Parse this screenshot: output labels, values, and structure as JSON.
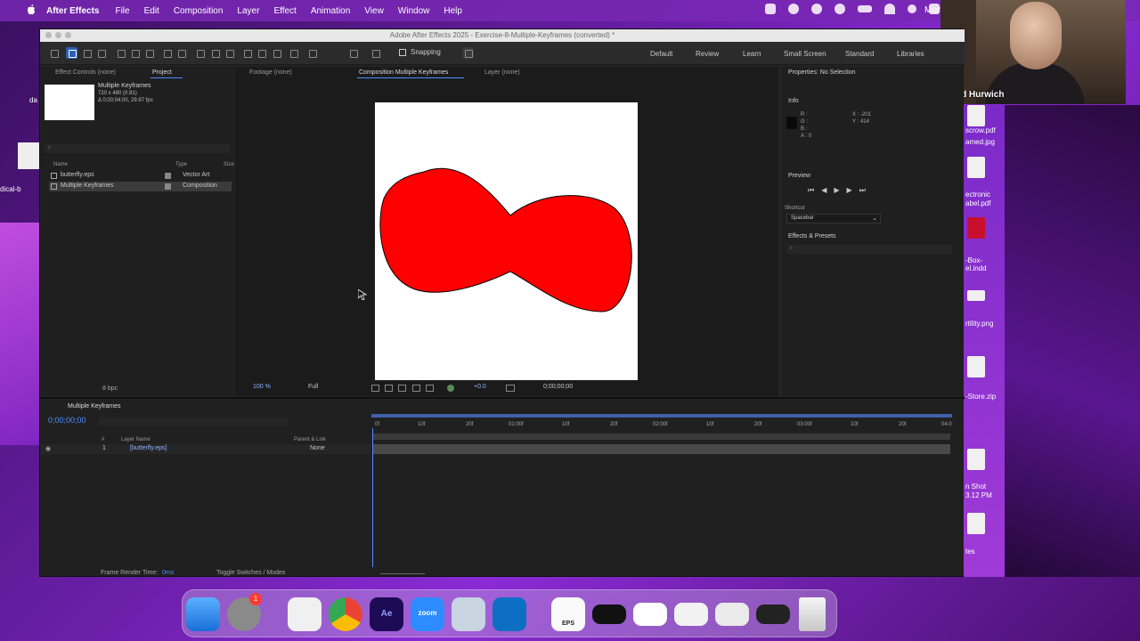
{
  "menubar": {
    "app_name": "After Effects",
    "items": [
      "File",
      "Edit",
      "Composition",
      "Layer",
      "Effect",
      "Animation",
      "View",
      "Window",
      "Help"
    ],
    "clock": "Mon"
  },
  "desktop_left": {
    "label1": "da",
    "label2": "dical-b"
  },
  "desktop_right": {
    "files": [
      "scrow.pdf",
      "amed.jpg",
      "ectronic",
      "abel.pdf",
      "-Box-",
      "el.indd",
      "rtility.png",
      "-Store.zip",
      "n Shot",
      "3.12 PM",
      "tes"
    ]
  },
  "webcam": {
    "name": "David Hurwich"
  },
  "window": {
    "title": "Adobe After Effects 2025 - Exercise-8-Multiple-Keyframes (converted) *"
  },
  "toolbar": {
    "snapping_label": "Snapping",
    "workspaces": [
      "Default",
      "Review",
      "Learn",
      "Small Screen",
      "Standard",
      "Libraries"
    ]
  },
  "project_panel": {
    "tabs": [
      "Effect Controls (none)",
      "Project"
    ],
    "selected_name": "Multiple Keyframes",
    "selected_dims": "720 x 480 (0.91)",
    "selected_meta": "Δ 0;00;04;00, 29.97 fps",
    "columns": [
      "Name",
      "Type",
      "Size"
    ],
    "rows": [
      {
        "name": "butterfly.eps",
        "type": "Vector Art"
      },
      {
        "name": "Multiple Keyframes",
        "type": "Composition"
      }
    ],
    "bpc": "8 bpc"
  },
  "viewer": {
    "tabs": [
      "Footage (none)",
      "Composition Multiple Keyframes",
      "Layer (none)"
    ],
    "zoom": "100 %",
    "resolution": "Full",
    "exposure": "+0.0",
    "timecode": "0;00;00;00"
  },
  "properties": {
    "title": "Properties: No Selection"
  },
  "info": {
    "title": "Info",
    "channels": [
      "R :",
      "G :",
      "B :",
      "A : 0"
    ],
    "coords": [
      "X : -201",
      "Y : 414"
    ]
  },
  "preview": {
    "title": "Preview",
    "shortcut_label": "Shortcut",
    "shortcut_value": "Spacebar"
  },
  "effects_presets": {
    "title": "Effects & Presets"
  },
  "timeline": {
    "comp_tab": "Multiple Keyframes",
    "timecode": "0;00;00;00",
    "columns": [
      "#",
      "Layer Name",
      "Parent & Link"
    ],
    "layer": {
      "index": "1",
      "name": "[butterfly.eps]",
      "parent": "None"
    },
    "ruler": [
      "0f",
      "10f",
      "20f",
      "01:00f",
      "10f",
      "20f",
      "02:00f",
      "10f",
      "20f",
      "03:00f",
      "10f",
      "20f",
      "04:0"
    ],
    "frame_render": "Frame Render Time:",
    "frame_render_value": "0ms",
    "toggle_label": "Toggle Switches / Modes"
  },
  "dock": {
    "badge": "1",
    "zoom_label": "zoom",
    "ae_label": "Ae",
    "eps_label": "EPS"
  },
  "colors": {
    "butterfly_fill": "#ff0000",
    "accent": "#2d5fb5",
    "timecode": "#4f8fff"
  }
}
